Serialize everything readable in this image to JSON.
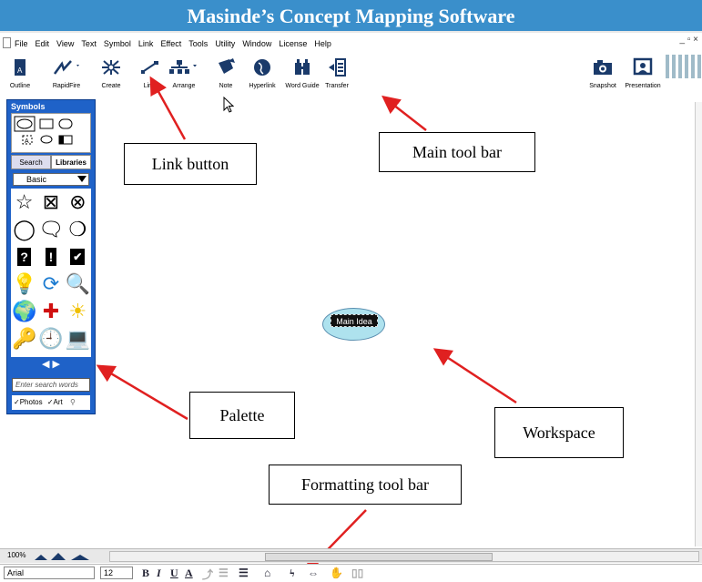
{
  "window": {
    "title": "Masinde’s Concept Mapping Software"
  },
  "menu": {
    "items": [
      "File",
      "Edit",
      "View",
      "Text",
      "Symbol",
      "Link",
      "Effect",
      "Tools",
      "Utility",
      "Window",
      "License",
      "Help"
    ],
    "window_controls": "_ ▫ ×"
  },
  "toolbar": {
    "outline": "Outline",
    "rapidfire": "RapidFire",
    "create": "Create",
    "link": "Link",
    "arrange": "Arrange",
    "note": "Note",
    "hyperlink": "Hyperlink",
    "word_guide": "Word Guide",
    "transfer": "Transfer",
    "snapshot": "Snapshot",
    "presentation": "Presentation"
  },
  "palette": {
    "title": "Symbols",
    "tabs": {
      "search": "Search",
      "libraries": "Libraries"
    },
    "library_select": "Basic",
    "nav": "◀ ▶",
    "search_placeholder": "Enter search words",
    "photos_label": "Photos",
    "art_label": "Art"
  },
  "callouts": {
    "link_button": "Link button",
    "main_tool_bar": "Main tool bar",
    "palette": "Palette",
    "workspace": "Workspace",
    "formatting_tool_bar": "Formatting tool bar"
  },
  "workspace": {
    "main_idea": "Main Idea"
  },
  "bottom": {
    "zoom": "100%"
  },
  "format": {
    "font": "Arial",
    "size": "12",
    "bold": "B",
    "italic": "I",
    "underline": "U",
    "color": "A"
  },
  "colors": {
    "title_bg": "#3a8fcb",
    "palette_bg": "#1f62c8",
    "arrow": "#e02020",
    "node_fill": "#aee2ee"
  }
}
